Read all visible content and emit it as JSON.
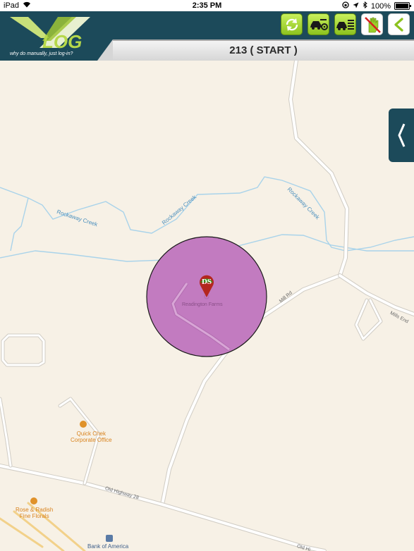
{
  "status_bar": {
    "device": "iPad",
    "time": "2:35 PM",
    "battery": "100%"
  },
  "header": {
    "logo_text": "LOG",
    "tagline": "why do manually, just log-in?",
    "title": "213 ( START )",
    "toolbar": [
      {
        "name": "refresh-button",
        "icon": "refresh-icon"
      },
      {
        "name": "vehicle-settings-button",
        "icon": "car-gear-icon"
      },
      {
        "name": "vehicle-list-button",
        "icon": "car-list-icon"
      },
      {
        "name": "no-touch-button",
        "icon": "hand-prohibited-icon"
      },
      {
        "name": "back-button",
        "icon": "chevron-left-icon"
      }
    ]
  },
  "map": {
    "marker_label": "DS",
    "geofence_color": "#c27bc0",
    "place_name": "Readington Farms",
    "creek_labels": [
      "Rockaway Creek",
      "Rockaway Creek",
      "Rockaway Creek"
    ],
    "road_labels": [
      "Mill Rd",
      "Mills End",
      "Old Highway 28",
      "Old Hi..."
    ],
    "pois": [
      {
        "name": "Quick Chek\nCorporate Office",
        "line1": "Quick Chek",
        "line2": "Corporate Office"
      },
      {
        "name": "Rose & Radish\nFine Florals",
        "line1": "Rose & Radish",
        "line2": "Fine Florals"
      },
      {
        "name": "Bank of America",
        "line1": "Bank of America"
      }
    ]
  },
  "colors": {
    "header_bg": "#1c4a5a",
    "button_green": "#9bcf2a",
    "map_bg": "#f7f1e6",
    "water": "#a9d3ea",
    "marker_red": "#b3261e",
    "marker_green": "#3f8f1f"
  }
}
